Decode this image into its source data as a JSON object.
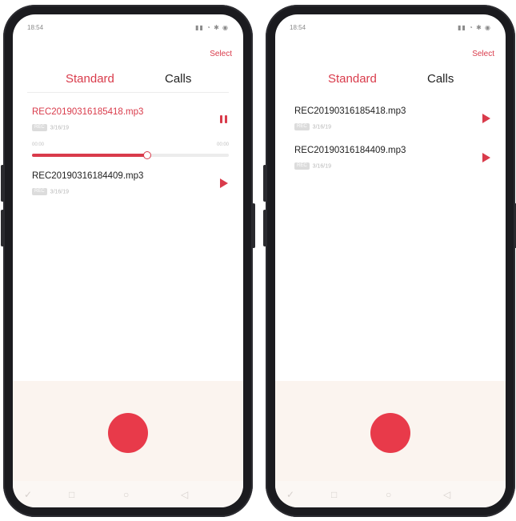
{
  "screens": [
    {
      "status": {
        "time": "18:54",
        "icons": "▮▮ ◔ ✱ ◉"
      },
      "select_label": "Select",
      "tabs": [
        {
          "label": "Standard"
        },
        {
          "label": "Calls"
        }
      ],
      "recordings": [
        {
          "name": "REC20190316185418.mp3",
          "tag": "REC",
          "date": "3/16/19",
          "state": "playing"
        },
        {
          "name": "REC20190316184409.mp3",
          "tag": "REC",
          "date": "3/16/19",
          "state": "paused"
        }
      ],
      "progress": {
        "start": "00:00",
        "end": "00:00",
        "fraction": 0.58
      },
      "nav_icons": [
        "back-check-icon",
        "square-icon",
        "circle-icon",
        "triangle-icon"
      ]
    },
    {
      "status": {
        "time": "18:54",
        "icons": "▮▮ ◔ ✱ ◉"
      },
      "select_label": "Select",
      "tabs": [
        {
          "label": "Standard"
        },
        {
          "label": "Calls"
        }
      ],
      "recordings": [
        {
          "name": "REC20190316185418.mp3",
          "tag": "REC",
          "date": "3/16/19",
          "state": "paused"
        },
        {
          "name": "REC20190316184409.mp3",
          "tag": "REC",
          "date": "3/16/19",
          "state": "paused"
        }
      ],
      "nav_icons": [
        "back-check-icon",
        "square-icon",
        "circle-icon",
        "triangle-icon"
      ]
    }
  ],
  "colors": {
    "accent": "#d93b4b",
    "record": "#e83a4a",
    "panel": "#fbf4ef"
  }
}
